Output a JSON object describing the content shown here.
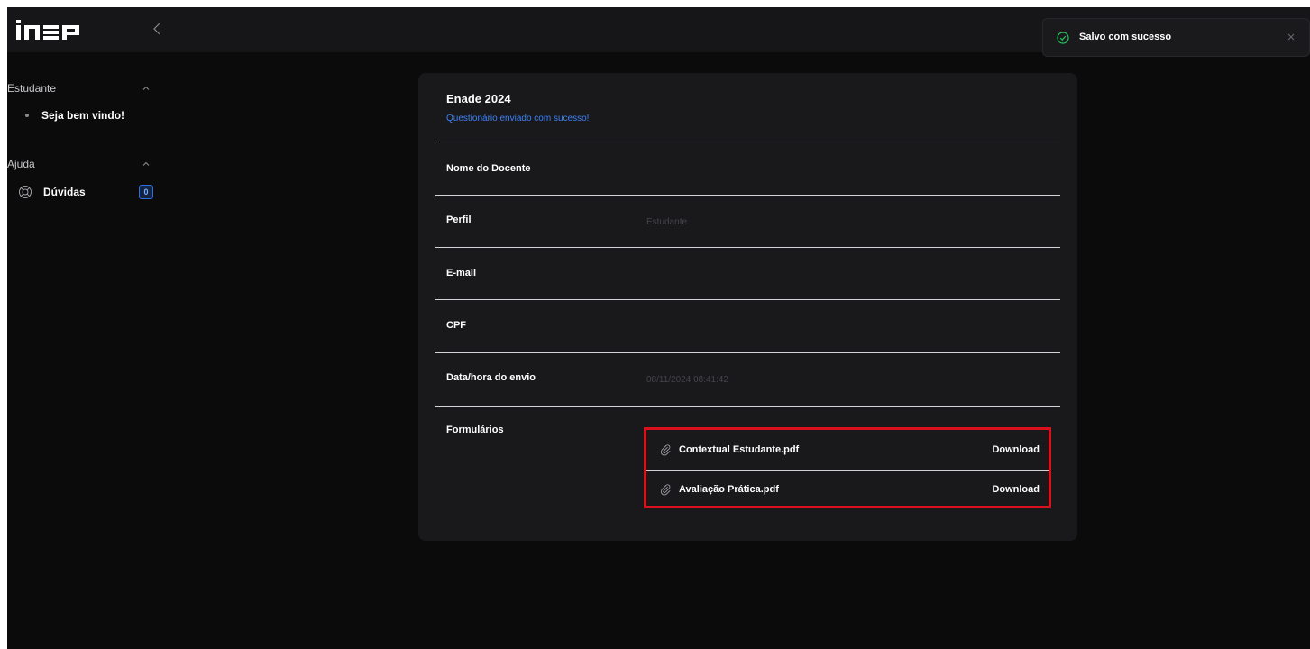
{
  "header": {
    "logo_text": "INEP",
    "collapse_icon": "chevron-left-icon"
  },
  "sidebar": {
    "sections": [
      {
        "title": "Estudante",
        "icon": "chevron-up-icon",
        "items": [
          {
            "label": "Seja bem vindo!",
            "icon": "bullet-dot"
          }
        ]
      },
      {
        "title": "Ajuda",
        "icon": "chevron-up-icon",
        "items": [
          {
            "label": "Dúvidas",
            "icon": "lifebuoy-icon",
            "badge": "0"
          }
        ]
      }
    ]
  },
  "card": {
    "title": "Enade 2024",
    "subtitle": "Questionário enviado com sucesso!",
    "fields": [
      {
        "label": "Nome do Docente",
        "value": ""
      },
      {
        "label": "Perfil",
        "value": "Estudante"
      },
      {
        "label": "E-mail",
        "value": ""
      },
      {
        "label": "CPF",
        "value": ""
      },
      {
        "label": "Data/hora do envio",
        "value": "08/11/2024 08:41:42"
      }
    ],
    "forms_label": "Formulários",
    "files": [
      {
        "name": "Contextual Estudante.pdf",
        "action": "Download",
        "icon": "paperclip-icon"
      },
      {
        "name": "Avaliação Prática.pdf",
        "action": "Download",
        "icon": "paperclip-icon"
      }
    ]
  },
  "toast": {
    "message": "Salvo com sucesso",
    "icon": "check-circle-icon",
    "close_icon": "close-icon"
  },
  "colors": {
    "background": "#0b0b0c",
    "card": "#19191c",
    "accent_blue": "#3b82f6",
    "success_green": "#22c55e",
    "highlight_red": "#d8111d"
  }
}
